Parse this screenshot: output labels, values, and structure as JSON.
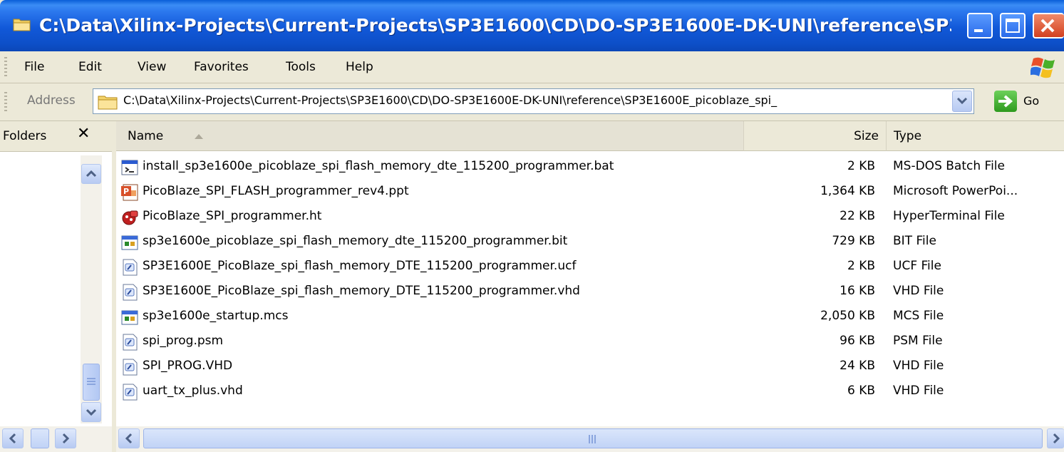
{
  "window": {
    "title": "C:\\Data\\Xilinx-Projects\\Current-Projects\\SP3E1600\\CD\\DO-SP3E1600E-DK-UNI\\reference\\SP3E16...",
    "colors": {
      "title_bar": "#0d4fc8",
      "close_button": "#d2401f",
      "chrome": "#ece9d8"
    }
  },
  "menu": {
    "items": [
      "File",
      "Edit",
      "View",
      "Favorites",
      "Tools",
      "Help"
    ]
  },
  "address": {
    "label": "Address",
    "path": "C:\\Data\\Xilinx-Projects\\Current-Projects\\SP3E1600\\CD\\DO-SP3E1600E-DK-UNI\\reference\\SP3E1600E_picoblaze_spi_",
    "go_label": "Go"
  },
  "folders_pane": {
    "label": "Folders",
    "close_symbol": "✕"
  },
  "columns": {
    "name": "Name",
    "size": "Size",
    "type": "Type"
  },
  "files": [
    {
      "name": "install_sp3e1600e_picoblaze_spi_flash_memory_dte_115200_programmer.bat",
      "size": "2 KB",
      "type": "MS-DOS Batch File",
      "icon": "batch-file-icon"
    },
    {
      "name": "PicoBlaze_SPI_FLASH_programmer_rev4.ppt",
      "size": "1,364 KB",
      "type": "Microsoft PowerPoi...",
      "icon": "powerpoint-file-icon"
    },
    {
      "name": "PicoBlaze_SPI_programmer.ht",
      "size": "22 KB",
      "type": "HyperTerminal File",
      "icon": "hyperterminal-file-icon"
    },
    {
      "name": "sp3e1600e_picoblaze_spi_flash_memory_dte_115200_programmer.bit",
      "size": "729 KB",
      "type": "BIT File",
      "icon": "app-file-icon"
    },
    {
      "name": "SP3E1600E_PicoBlaze_spi_flash_memory_DTE_115200_programmer.ucf",
      "size": "2 KB",
      "type": "UCF File",
      "icon": "text-file-icon"
    },
    {
      "name": "SP3E1600E_PicoBlaze_spi_flash_memory_DTE_115200_programmer.vhd",
      "size": "16 KB",
      "type": "VHD File",
      "icon": "text-file-icon"
    },
    {
      "name": "sp3e1600e_startup.mcs",
      "size": "2,050 KB",
      "type": "MCS File",
      "icon": "app-file-icon"
    },
    {
      "name": "spi_prog.psm",
      "size": "96 KB",
      "type": "PSM File",
      "icon": "text-file-icon"
    },
    {
      "name": "SPI_PROG.VHD",
      "size": "24 KB",
      "type": "VHD File",
      "icon": "text-file-icon"
    },
    {
      "name": "uart_tx_plus.vhd",
      "size": "6 KB",
      "type": "VHD File",
      "icon": "text-file-icon"
    }
  ]
}
